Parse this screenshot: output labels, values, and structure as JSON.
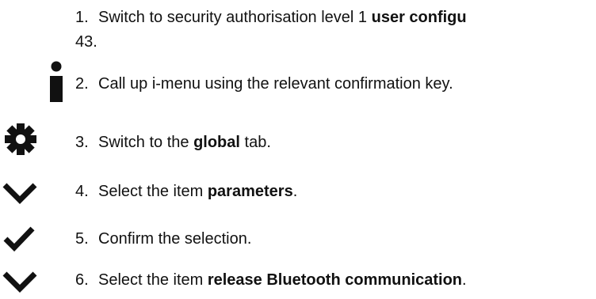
{
  "steps": [
    {
      "number": "1.",
      "text_before": "Switch to security authorisation level 1 ",
      "bold": "user configu",
      "text_after": "",
      "continuation": "43.",
      "icon": null
    },
    {
      "number": "2.",
      "text_before": "Call up i-menu using the relevant confirmation key.",
      "bold": "",
      "text_after": "",
      "icon": "info-i-icon"
    },
    {
      "number": "3.",
      "text_before": "Switch to the ",
      "bold": "global",
      "text_after": " tab.",
      "icon": "gear-icon"
    },
    {
      "number": "4.",
      "text_before": "Select the item ",
      "bold": "parameters",
      "text_after": ".",
      "icon": "chevron-down-icon"
    },
    {
      "number": "5.",
      "text_before": "Confirm the selection.",
      "bold": "",
      "text_after": "",
      "icon": "checkmark-icon"
    },
    {
      "number": "6.",
      "text_before": "Select the item ",
      "bold": "release Bluetooth communication",
      "text_after": ".",
      "icon": "chevron-down-icon"
    }
  ],
  "colors": {
    "text": "#111111",
    "icon": "#111111",
    "background": "#ffffff"
  }
}
